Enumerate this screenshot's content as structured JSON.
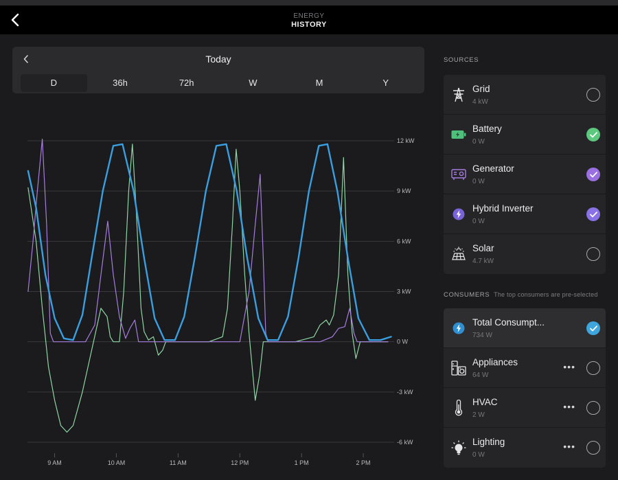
{
  "header": {
    "eyebrow": "ENERGY",
    "title": "HISTORY"
  },
  "range": {
    "title": "Today",
    "tabs": [
      {
        "label": "D",
        "active": true
      },
      {
        "label": "36h"
      },
      {
        "label": "72h"
      },
      {
        "label": "W"
      },
      {
        "label": "M"
      },
      {
        "label": "Y"
      }
    ]
  },
  "sources": {
    "title": "SOURCES",
    "items": [
      {
        "name": "Grid",
        "value": "4 kW",
        "icon": "grid-tower-icon",
        "checked": false
      },
      {
        "name": "Battery",
        "value": "0 W",
        "icon": "battery-icon",
        "checked": true,
        "color": "#5dc97e"
      },
      {
        "name": "Generator",
        "value": "0 W",
        "icon": "generator-icon",
        "checked": true,
        "color": "#9a6fe0"
      },
      {
        "name": "Hybrid Inverter",
        "value": "0 W",
        "icon": "lightning-icon",
        "checked": true,
        "color": "#8a72e6"
      },
      {
        "name": "Solar",
        "value": "4.7 kW",
        "icon": "solar-panel-icon",
        "checked": false
      }
    ]
  },
  "consumers": {
    "title": "CONSUMERS",
    "hint": "The top consumers are pre-selected",
    "items": [
      {
        "name": "Total Consumpt...",
        "value": "734 W",
        "icon": "lightning-icon",
        "checked": true,
        "color": "#3ea6dc",
        "highlight": true
      },
      {
        "name": "Appliances",
        "value": "64 W",
        "icon": "appliances-icon",
        "checked": false,
        "more": "•••"
      },
      {
        "name": "HVAC",
        "value": "2 W",
        "icon": "thermometer-icon",
        "checked": false,
        "more": "•••"
      },
      {
        "name": "Lighting",
        "value": "0 W",
        "icon": "lightbulb-icon",
        "checked": false,
        "more": "•••"
      }
    ]
  },
  "colors": {
    "total_consumption": "#3a9fe0",
    "battery": "#8fd6a4",
    "generator": "#a77de0",
    "grid_line": "#3a3a3e"
  },
  "chart_data": {
    "type": "line",
    "x_unit": "hours",
    "xlim": [
      8.56,
      14.5
    ],
    "ylim": [
      -6,
      12
    ],
    "y_ticks": [
      {
        "value": 12,
        "label": "12 kW"
      },
      {
        "value": 9,
        "label": "9 kW"
      },
      {
        "value": 6,
        "label": "6 kW"
      },
      {
        "value": 3,
        "label": "3 kW"
      },
      {
        "value": 0,
        "label": "0 W"
      },
      {
        "value": -3,
        "label": "-3 kW"
      },
      {
        "value": -6,
        "label": "-6 kW"
      }
    ],
    "x_ticks": [
      {
        "value": 9,
        "label": "9 AM"
      },
      {
        "value": 10,
        "label": "10 AM"
      },
      {
        "value": 11,
        "label": "11 AM"
      },
      {
        "value": 12,
        "label": "12 PM"
      },
      {
        "value": 13,
        "label": "1 PM"
      },
      {
        "value": 14,
        "label": "2 PM"
      }
    ],
    "series": [
      {
        "key": "total_consumption",
        "points": [
          [
            8.57,
            10.2
          ],
          [
            8.7,
            8
          ],
          [
            8.85,
            4
          ],
          [
            9.0,
            1.4
          ],
          [
            9.15,
            0.2
          ],
          [
            9.3,
            0.1
          ],
          [
            9.45,
            1.6
          ],
          [
            9.6,
            5
          ],
          [
            9.78,
            9
          ],
          [
            9.95,
            11.7
          ],
          [
            10.1,
            11.8
          ],
          [
            10.28,
            9
          ],
          [
            10.45,
            5
          ],
          [
            10.62,
            1.4
          ],
          [
            10.78,
            0.1
          ],
          [
            10.95,
            0.1
          ],
          [
            11.1,
            1.5
          ],
          [
            11.27,
            5
          ],
          [
            11.45,
            9
          ],
          [
            11.62,
            11.7
          ],
          [
            11.78,
            11.8
          ],
          [
            11.95,
            9
          ],
          [
            12.12,
            5
          ],
          [
            12.3,
            1.4
          ],
          [
            12.45,
            0.1
          ],
          [
            12.62,
            0.1
          ],
          [
            12.78,
            1.5
          ],
          [
            12.95,
            5
          ],
          [
            13.12,
            9
          ],
          [
            13.28,
            11.7
          ],
          [
            13.42,
            11.8
          ],
          [
            13.58,
            9
          ],
          [
            13.75,
            5
          ],
          [
            13.92,
            1.4
          ],
          [
            14.1,
            0.1
          ],
          [
            14.28,
            0.1
          ],
          [
            14.45,
            0.3
          ]
        ]
      },
      {
        "key": "battery",
        "points": [
          [
            8.57,
            9.2
          ],
          [
            8.7,
            6
          ],
          [
            8.8,
            2
          ],
          [
            8.9,
            -1.5
          ],
          [
            9.0,
            -3.5
          ],
          [
            9.1,
            -5
          ],
          [
            9.2,
            -5.4
          ],
          [
            9.3,
            -5
          ],
          [
            9.45,
            -3
          ],
          [
            9.6,
            -0.5
          ],
          [
            9.75,
            2
          ],
          [
            9.85,
            1.5
          ],
          [
            9.9,
            0.3
          ],
          [
            9.95,
            0
          ],
          [
            10.05,
            0
          ],
          [
            10.12,
            3
          ],
          [
            10.2,
            9
          ],
          [
            10.26,
            11.8
          ],
          [
            10.32,
            8
          ],
          [
            10.4,
            2
          ],
          [
            10.45,
            0.6
          ],
          [
            10.52,
            0.1
          ],
          [
            10.6,
            0.3
          ],
          [
            10.68,
            -0.8
          ],
          [
            10.75,
            -0.5
          ],
          [
            10.8,
            0
          ],
          [
            11.3,
            0
          ],
          [
            11.5,
            0
          ],
          [
            11.72,
            0.3
          ],
          [
            11.8,
            2
          ],
          [
            11.88,
            7
          ],
          [
            11.94,
            11.5
          ],
          [
            12.0,
            9
          ],
          [
            12.08,
            4
          ],
          [
            12.15,
            0.5
          ],
          [
            12.2,
            -1.5
          ],
          [
            12.25,
            -3.5
          ],
          [
            12.32,
            -2
          ],
          [
            12.38,
            0
          ],
          [
            12.5,
            0
          ],
          [
            12.9,
            0
          ],
          [
            13.2,
            0.3
          ],
          [
            13.3,
            1
          ],
          [
            13.4,
            1.3
          ],
          [
            13.45,
            1
          ],
          [
            13.52,
            1.6
          ],
          [
            13.6,
            4
          ],
          [
            13.68,
            11
          ],
          [
            13.75,
            4
          ],
          [
            13.82,
            0.5
          ],
          [
            13.88,
            -1
          ],
          [
            13.95,
            0
          ],
          [
            14.05,
            0
          ],
          [
            14.4,
            0
          ]
        ]
      },
      {
        "key": "generator",
        "points": [
          [
            8.57,
            3
          ],
          [
            8.65,
            6
          ],
          [
            8.72,
            9
          ],
          [
            8.8,
            12.1
          ],
          [
            8.87,
            7
          ],
          [
            8.93,
            0.5
          ],
          [
            8.98,
            0
          ],
          [
            9.2,
            0
          ],
          [
            9.5,
            0
          ],
          [
            9.65,
            1
          ],
          [
            9.75,
            4
          ],
          [
            9.86,
            7.2
          ],
          [
            9.95,
            4
          ],
          [
            10.05,
            1.5
          ],
          [
            10.15,
            0.2
          ],
          [
            10.22,
            0.8
          ],
          [
            10.3,
            1.3
          ],
          [
            10.36,
            0
          ],
          [
            10.45,
            0
          ],
          [
            11.0,
            0
          ],
          [
            11.5,
            0
          ],
          [
            12.0,
            0
          ],
          [
            12.15,
            3
          ],
          [
            12.25,
            7
          ],
          [
            12.33,
            10
          ],
          [
            12.38,
            5
          ],
          [
            12.42,
            0.5
          ],
          [
            12.46,
            0
          ],
          [
            12.6,
            0
          ],
          [
            13.3,
            0
          ],
          [
            13.5,
            0.3
          ],
          [
            13.6,
            0.8
          ],
          [
            13.7,
            0.9
          ],
          [
            13.78,
            2
          ],
          [
            13.85,
            0.5
          ],
          [
            13.9,
            0
          ],
          [
            14.0,
            0
          ],
          [
            14.4,
            0
          ]
        ]
      }
    ]
  }
}
